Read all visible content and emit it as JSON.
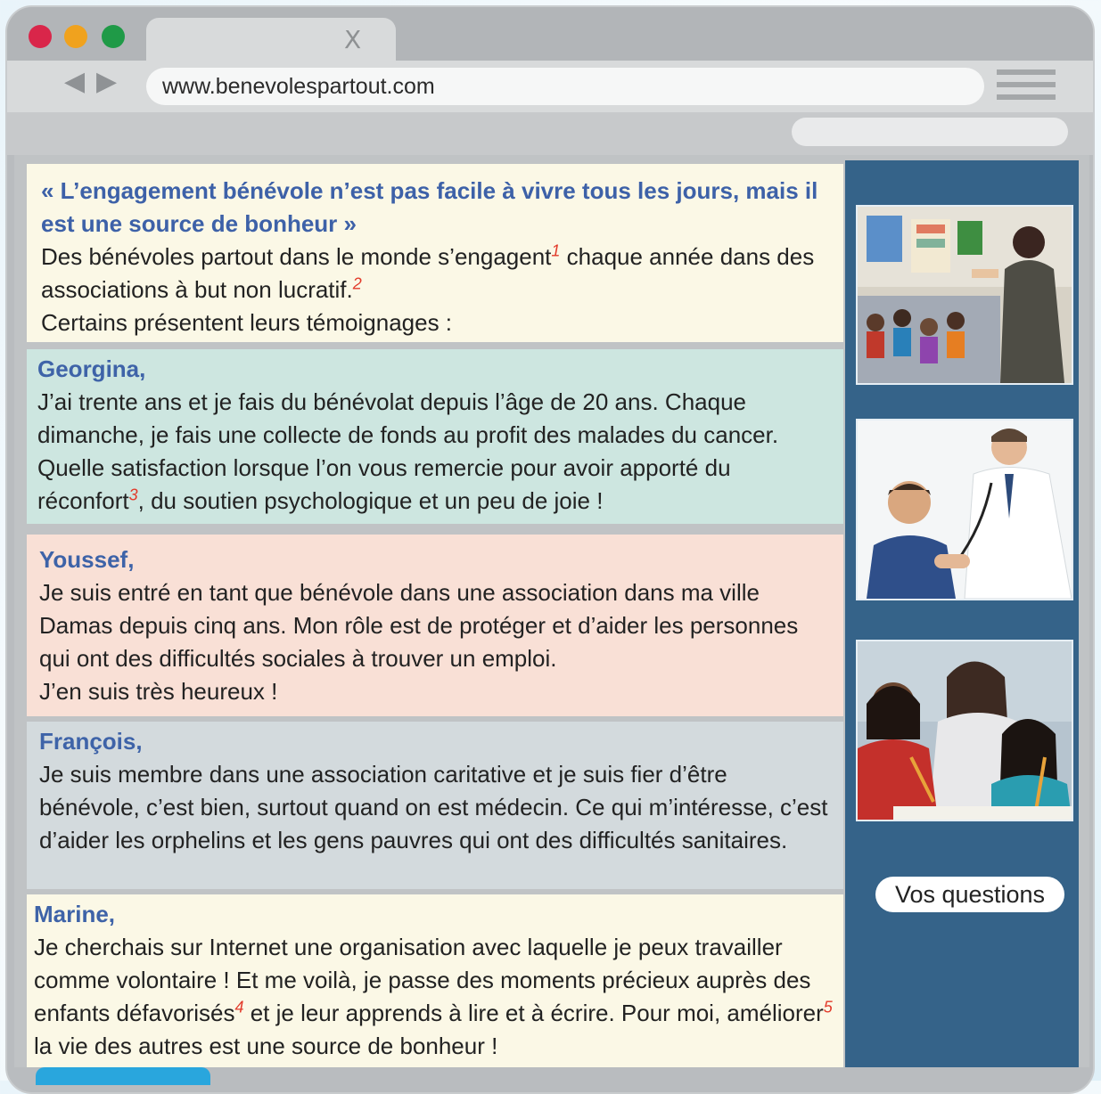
{
  "browser": {
    "url": "www.benevolespartout.com",
    "tab_close": "X",
    "back": "◀",
    "forward": "▶"
  },
  "intro": {
    "headline": "« L’engagement bénévole n’est pas facile à vivre tous les jours, mais il est une source de bonheur »",
    "p1": "Des bénévoles partout dans le monde s’engagent",
    "fn1": "1",
    "p2": " chaque année dans des associations à but non lucratif.",
    "fn2": "2",
    "p3": "Certains présentent leurs témoignages :"
  },
  "testimonials": {
    "georgina": {
      "name": "Georgina,",
      "t1": " J’ai trente ans et je fais du bénévolat depuis l’âge de 20 ans. Chaque dimanche, je fais une collecte de fonds au profit des malades du cancer. Quelle satisfaction lorsque l’on vous remercie pour avoir apporté du réconfort",
      "fn": "3",
      "t2": ", du soutien psychologique et un peu de joie !"
    },
    "youssef": {
      "name": "Youssef,",
      "t1": "Je suis entré en tant que bénévole dans une association dans ma ville Damas depuis cinq ans. Mon rôle est de protéger et d’aider les personnes qui ont des difficultés sociales à trouver un emploi.",
      "t2": "J’en suis très heureux !"
    },
    "francois": {
      "name": "François,",
      "t1": "Je suis membre dans une association caritative et je suis fier d’être bénévole, c’est bien, surtout quand on est médecin. Ce qui m’intéresse, c’est d’aider les orphelins et les gens pauvres qui ont des difficultés sanitaires."
    },
    "marine": {
      "name": "Marine,",
      "t1": "Je cherchais sur Internet une organisation avec laquelle je peux travailler comme volontaire ! Et me voilà, je passe des moments précieux auprès des enfants défavorisés",
      "fn4": "4",
      "t2": " et je leur apprends à lire et à écrire. Pour moi, améliorer",
      "fn5": "5",
      "t3": " la vie des autres est une source de bonheur !"
    }
  },
  "sidebar": {
    "button": "Vos questions"
  },
  "colors": {
    "sidebar": "#356389",
    "name": "#3e63a8",
    "footnote": "#e23a2a"
  }
}
